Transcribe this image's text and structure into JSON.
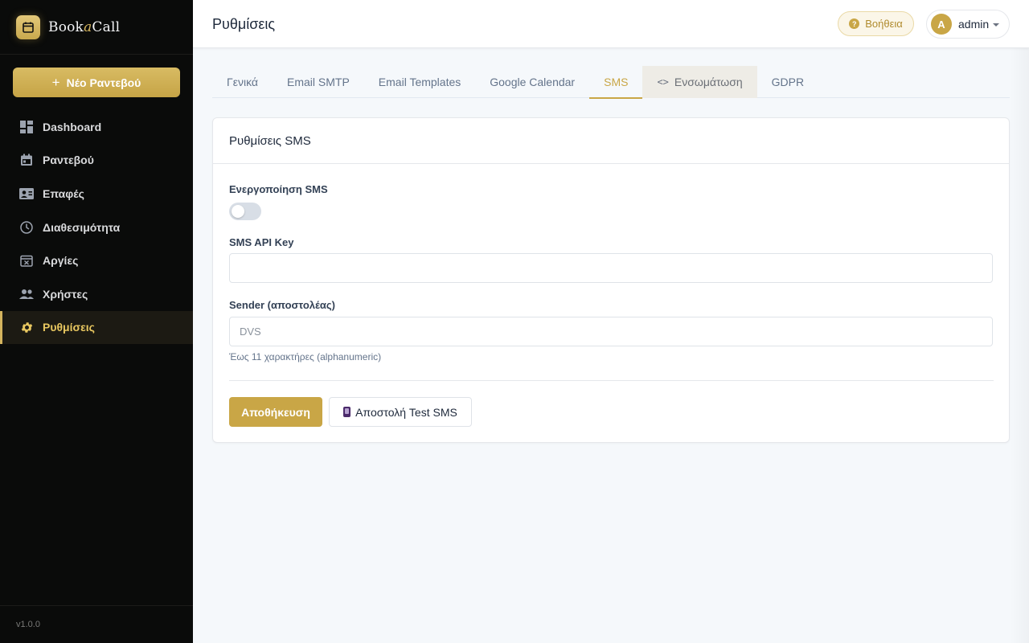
{
  "brand": {
    "name_part1": "Book",
    "name_accent": "a",
    "name_part2": "Call"
  },
  "sidebar": {
    "new_button": {
      "icon": "plus-icon",
      "label": "Νέο Ραντεβού"
    },
    "items": [
      {
        "label": "Dashboard",
        "icon": "dashboard-icon",
        "active": false
      },
      {
        "label": "Ραντεβού",
        "icon": "calendar-icon",
        "active": false
      },
      {
        "label": "Επαφές",
        "icon": "contacts-icon",
        "active": false
      },
      {
        "label": "Διαθεσιμότητα",
        "icon": "clock-icon",
        "active": false
      },
      {
        "label": "Αργίες",
        "icon": "calendar-x-icon",
        "active": false
      },
      {
        "label": "Χρήστες",
        "icon": "users-icon",
        "active": false
      },
      {
        "label": "Ρυθμίσεις",
        "icon": "gear-icon",
        "active": true
      }
    ],
    "version": "v1.0.0"
  },
  "header": {
    "title": "Ρυθμίσεις",
    "help_label": "Βοήθεια",
    "user": {
      "initial": "A",
      "name": "admin"
    }
  },
  "tabs": [
    {
      "label": "Γενικά",
      "active": false
    },
    {
      "label": "Email SMTP",
      "active": false
    },
    {
      "label": "Email Templates",
      "active": false
    },
    {
      "label": "Google Calendar",
      "active": false
    },
    {
      "label": "SMS",
      "active": true
    },
    {
      "label": "Ενσωμάτωση",
      "active": false,
      "icon": "code-icon"
    },
    {
      "label": "GDPR",
      "active": false
    }
  ],
  "card": {
    "title": "Ρυθμίσεις SMS",
    "enable_label": "Ενεργοποίηση SMS",
    "enable_value": false,
    "api_key_label": "SMS API Key",
    "api_key_value": "",
    "sender_label": "Sender (αποστολέας)",
    "sender_placeholder": "DVS",
    "sender_hint": "Έως 11 χαρακτήρες (alphanumeric)",
    "save_label": "Αποθήκευση",
    "test_label": "Αποστολή Test SMS"
  },
  "colors": {
    "accent": "#c9a646",
    "sidebar_bg": "#0a0b0a",
    "active_nav": "#e8c760"
  }
}
